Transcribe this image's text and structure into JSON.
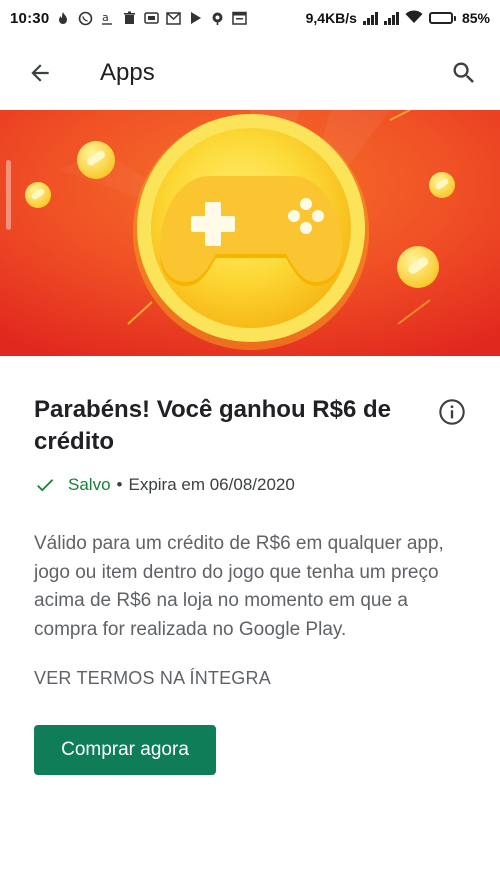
{
  "status_bar": {
    "time": "10:30",
    "network_speed": "9,4KB/s",
    "battery_percent": "85%",
    "battery_level": 0.85,
    "notification_icons": [
      "fire-icon",
      "whatsapp-icon",
      "amazon-icon",
      "trash-icon",
      "app-icon",
      "gmail-icon",
      "play-icon",
      "podcast-icon",
      "calendar-icon"
    ]
  },
  "app_bar": {
    "title": "Apps",
    "back_icon": "arrow-back-icon",
    "search_icon": "search-icon"
  },
  "banner": {
    "background_color": "#ea3b24",
    "coin_color": "#f7c51f",
    "icon": "gamepad-icon"
  },
  "offer": {
    "headline": "Parabéns! Você ganhou R$6 de crédito",
    "saved_label": "Salvo",
    "bullet": "•",
    "expiry": "Expira em 06/08/2020",
    "description": "Válido para um crédito de R$6 em qualquer app, jogo ou item dentro do jogo que tenha um preço acima de R$6 na loja no momento em que a compra for realizada no Google Play.",
    "terms_link": "VER TERMOS NA ÍNTEGRA",
    "cta_label": "Comprar agora",
    "cta_color": "#0f7d57",
    "saved_color": "#188038"
  }
}
